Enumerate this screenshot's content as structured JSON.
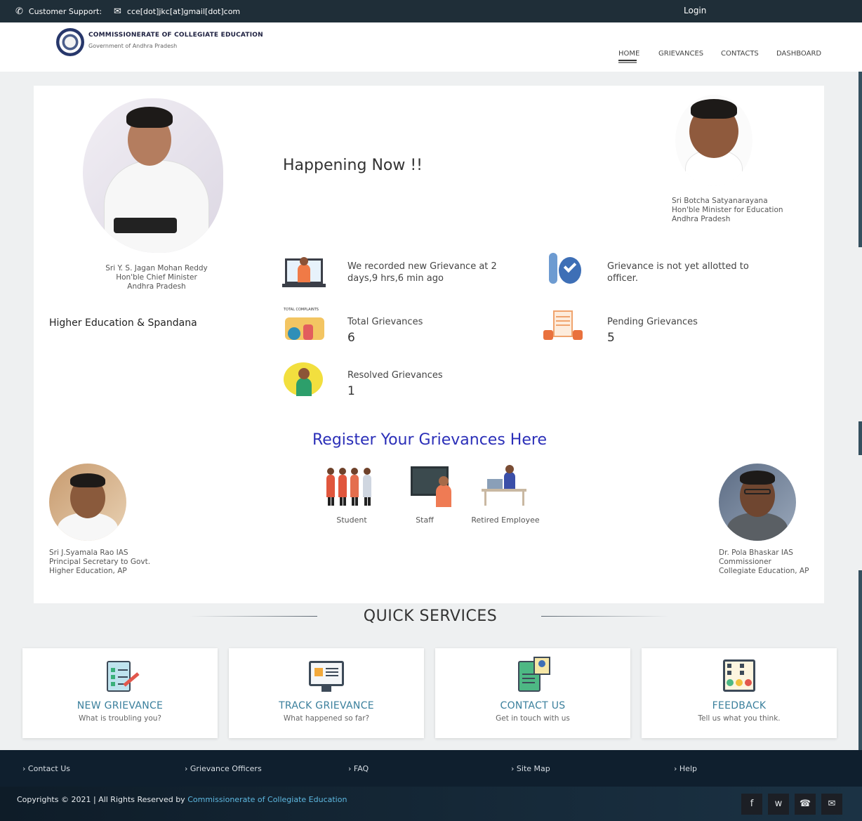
{
  "topbar": {
    "support_label": "Customer Support:",
    "email": "cce[dot]jkc[at]gmail[dot]com",
    "login_label": "Login"
  },
  "header": {
    "org_name": "COMMISSIONERATE OF COLLEGIATE EDUCATION",
    "org_sub": "Government of Andhra Pradesh",
    "nav": [
      "HOME",
      "GRIEVANCES",
      "CONTACTS",
      "DASHBOARD"
    ]
  },
  "officials": {
    "cm": [
      "Sri Y. S. Jagan Mohan Reddy",
      "Hon'ble Chief Minister",
      "Andhra Pradesh"
    ],
    "education_minister": [
      "Sri Botcha Satyanarayana",
      "Hon'ble Minister for Education",
      "Andhra Pradesh"
    ],
    "principal_secretary": [
      "Sri J.Syamala Rao IAS",
      "Principal Secretary to Govt.",
      "Higher Education, AP"
    ],
    "commissioner": [
      "Dr. Pola Bhaskar IAS",
      "Commissioner",
      "Collegiate Education, AP"
    ]
  },
  "section_tag": "Higher Education & Spandana",
  "happening": {
    "title": "Happening Now !!",
    "last_recorded": "We recorded new Grievance at 2 days,9 hrs,6 min ago",
    "not_allotted": "Grievance is not yet allotted to officer.",
    "total_label": "Total Grievances",
    "total_value": "6",
    "pending_label": "Pending Grievances",
    "pending_value": "5",
    "resolved_label": "Resolved Grievances",
    "resolved_value": "1",
    "total_icon_caption": "TOTAL COMPLAINTS"
  },
  "register": {
    "title": "Register Your Grievances Here",
    "options": [
      "Student",
      "Staff",
      "Retired Employee"
    ]
  },
  "quick_services": {
    "title": "QUICK SERVICES",
    "cards": [
      {
        "title": "NEW GRIEVANCE",
        "subtitle": "What is troubling you?",
        "icon": "notepad-pen-icon"
      },
      {
        "title": "TRACK GRIEVANCE",
        "subtitle": "What happened so far?",
        "icon": "monitor-list-icon"
      },
      {
        "title": "CONTACT US",
        "subtitle": "Get in touch with us",
        "icon": "contact-book-icon"
      },
      {
        "title": "FEEDBACK",
        "subtitle": "Tell us what you think.",
        "icon": "feedback-board-icon"
      }
    ]
  },
  "footer": {
    "links": [
      "Contact Us",
      "Grievance Officers",
      "FAQ",
      "Site Map",
      "Help"
    ],
    "copyright_prefix": "Copyrights © 2021 | All Rights Reserved by",
    "copyright_org": "Commissionerate of Collegiate Education",
    "social": [
      "f",
      "w",
      "☎",
      "✉"
    ]
  },
  "colors": {
    "topbar": "#1f2e38",
    "register_title": "#2b2fb8",
    "service_title": "#3a7f9c",
    "footer": "#0f1f2e"
  }
}
